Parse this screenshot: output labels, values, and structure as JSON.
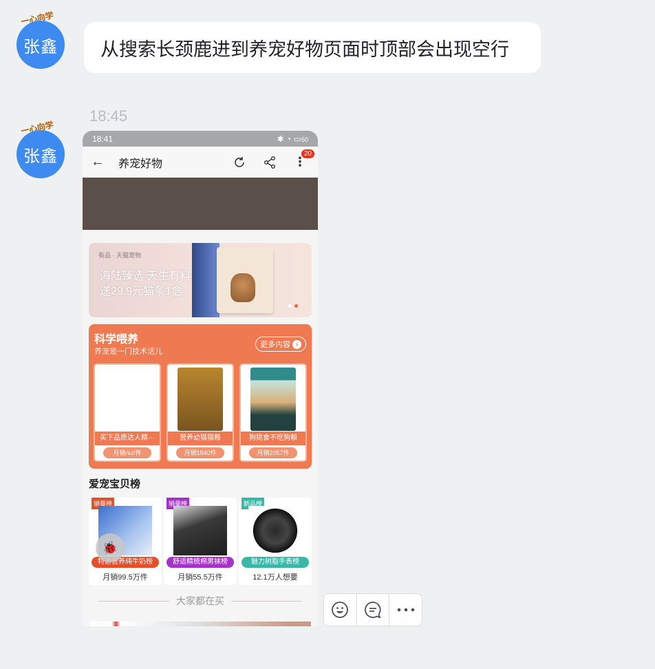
{
  "messages": [
    {
      "sender": "张鑫",
      "badge": "一心向学",
      "text": "从搜索长颈鹿进到养宠好物页面时顶部会出现空行"
    },
    {
      "sender": "张鑫",
      "badge": "一心向学",
      "timestamp": "18:45"
    }
  ],
  "phone": {
    "status_time": "18:41",
    "battery": "50",
    "page_title": "养宠好物",
    "badge_count": "20",
    "banner": {
      "brand": "有品 · 天猫宠物",
      "line1": "海陆臻选 天生有料",
      "line2": "送29.9元猫条1盒"
    },
    "science": {
      "title": "科学喂养",
      "subtitle": "养宠是一门技术活儿",
      "more": "更多内容",
      "products": [
        {
          "name": "买下品质达人精···",
          "sales": "月销null件"
        },
        {
          "name": "营养幼猫猫粮",
          "sales": "月销1840件"
        },
        {
          "name": "狗挑食不吃狗粮",
          "sales": "月销2057件"
        }
      ]
    },
    "ranking": {
      "title": "爱宠宝贝榜",
      "items": [
        {
          "tag": "销量榜",
          "tag_color": "#e2502a",
          "pill": "特惠营养纯牛奶榜",
          "pill_color": "#e2502a",
          "sub": "月销99.5万件"
        },
        {
          "tag": "销量榜",
          "tag_color": "#a533c7",
          "pill": "舒适精梳棉男袜榜",
          "pill_color": "#a533c7",
          "sub": "月销55.5万件"
        },
        {
          "tag": "新品榜",
          "tag_color": "#3bb7a8",
          "pill": "魅力树脂手表榜",
          "pill_color": "#3bb7a8",
          "sub": "12.1万人想要"
        }
      ]
    },
    "everyone_buying": "大家都在买"
  },
  "icons": {
    "back": "back-arrow-icon",
    "refresh": "refresh-icon",
    "share": "share-icon",
    "more": "more-vertical-icon",
    "bug": "bug-icon"
  },
  "colors": {
    "accent": "#ef7a52",
    "avatar": "#3d8bf0"
  }
}
